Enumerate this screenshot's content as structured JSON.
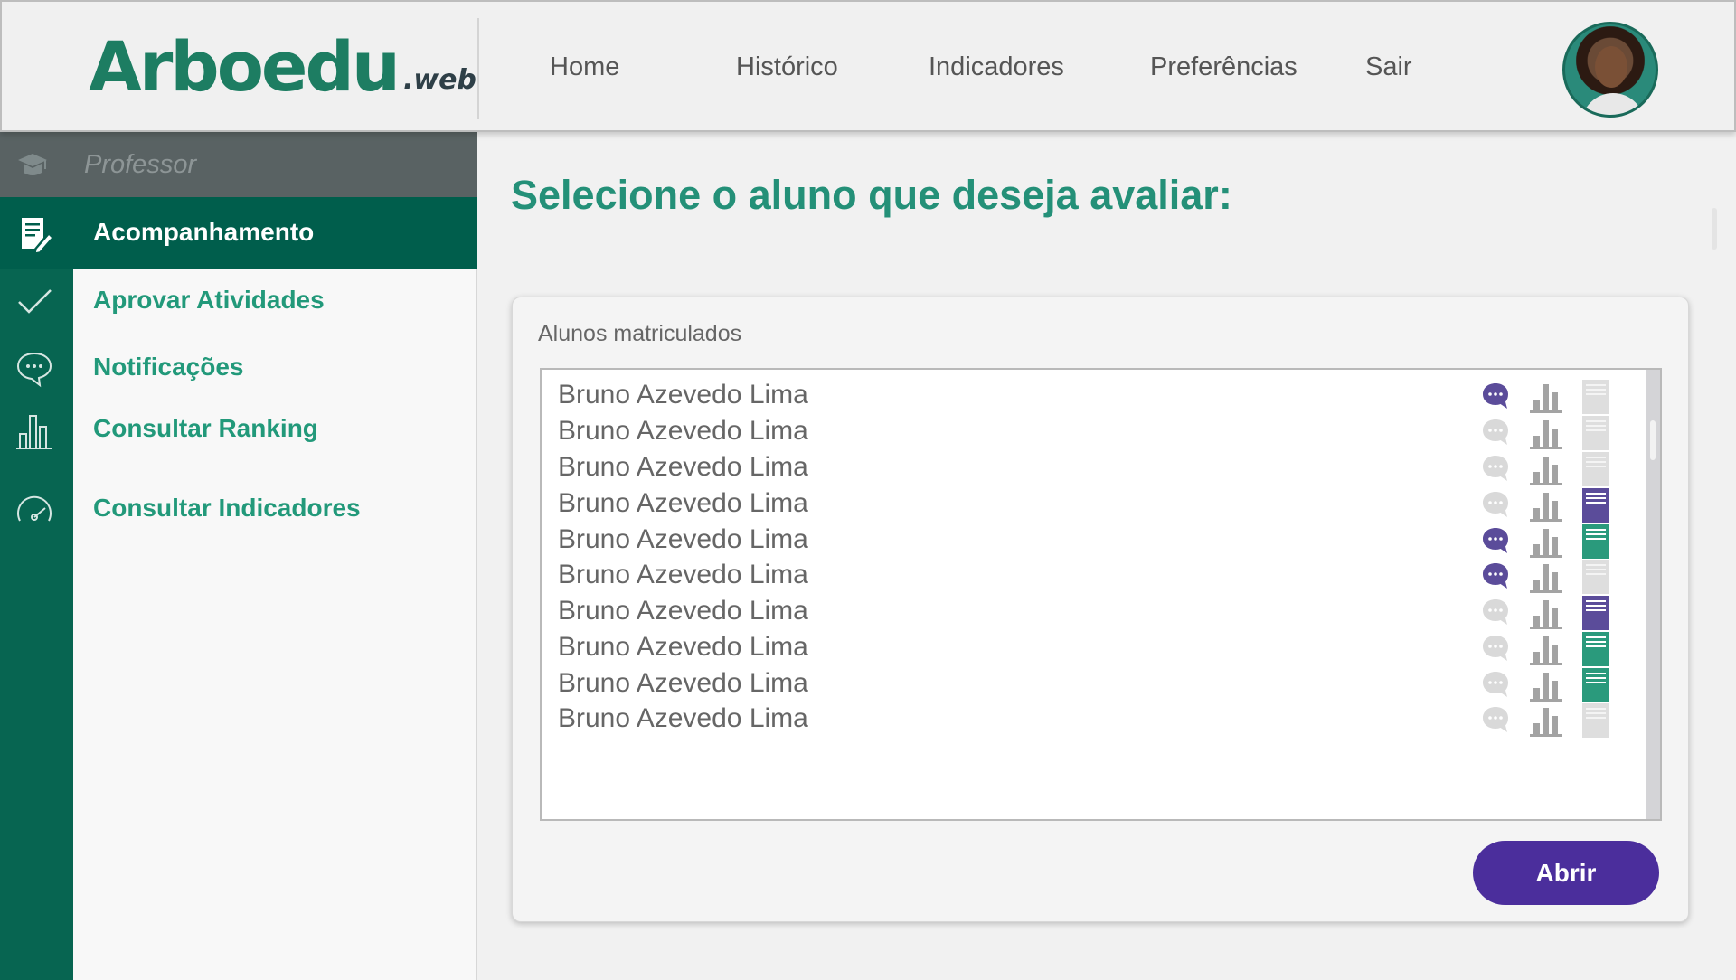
{
  "app": {
    "logo_main": "Arboedu",
    "logo_suffix": ".web"
  },
  "nav": {
    "items": [
      {
        "label": "Home",
        "icon": "home"
      },
      {
        "label": "Histórico"
      },
      {
        "label": "Indicadores"
      },
      {
        "label": "Preferências"
      },
      {
        "label": "Sair"
      }
    ],
    "avatar_icon": "user-avatar"
  },
  "sidebar": {
    "role": "Professor",
    "role_icon": "graduation-cap-icon",
    "items": [
      {
        "label": "Acompanhamento",
        "icon": "edit-document-icon",
        "active": true
      },
      {
        "label": "Aprovar Atividades",
        "icon": "checkmark-icon",
        "active": false
      },
      {
        "label": "Notificações",
        "icon": "chat-bubble-icon",
        "active": false
      },
      {
        "label": "Consultar Ranking",
        "icon": "bar-chart-icon",
        "active": false
      },
      {
        "label": "Consultar Indicadores",
        "icon": "gauge-icon",
        "active": false
      }
    ]
  },
  "main": {
    "title": "Selecione o aluno que deseja avaliar:",
    "list_label": "Alunos matriculados",
    "students": [
      {
        "name": "Bruno Azevedo Lima",
        "message": "active",
        "report": "none"
      },
      {
        "name": "Bruno Azevedo Lima",
        "message": "inactive",
        "report": "none"
      },
      {
        "name": "Bruno Azevedo Lima",
        "message": "inactive",
        "report": "none"
      },
      {
        "name": "Bruno Azevedo Lima",
        "message": "inactive",
        "report": "purple"
      },
      {
        "name": "Bruno Azevedo Lima",
        "message": "active",
        "report": "green"
      },
      {
        "name": "Bruno Azevedo Lima",
        "message": "active",
        "report": "none"
      },
      {
        "name": "Bruno Azevedo Lima",
        "message": "inactive",
        "report": "purple"
      },
      {
        "name": "Bruno Azevedo Lima",
        "message": "inactive",
        "report": "green"
      },
      {
        "name": "Bruno Azevedo Lima",
        "message": "inactive",
        "report": "green"
      },
      {
        "name": "Bruno Azevedo Lima",
        "message": "inactive",
        "report": "none"
      }
    ],
    "open_button": "Abrir"
  },
  "colors": {
    "brand_green": "#1d7d62",
    "active_menu": "#005e4c",
    "accent_purple": "#4b2e9c",
    "message_active": "#5b4c9a",
    "message_inactive": "#d9d9d9",
    "chart_icon": "#a3a3a3",
    "report_green": "#2a9a7c",
    "report_purple": "#5b4c9a",
    "report_none": "#dedede"
  }
}
